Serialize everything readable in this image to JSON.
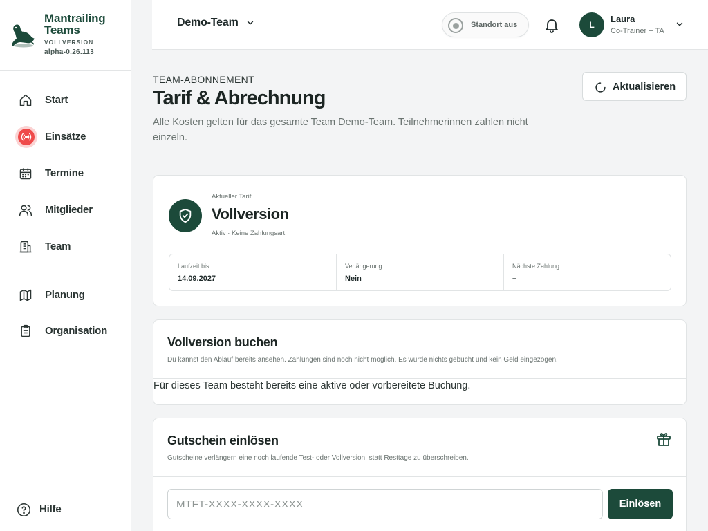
{
  "brand": {
    "title": "Mantrailing Teams",
    "plan": "VOLLVERSION",
    "version": "alpha-0.26.113"
  },
  "sidebar": {
    "items": [
      {
        "label": "Start",
        "icon": "home-icon"
      },
      {
        "label": "Einsätze",
        "icon": "alert-icon"
      },
      {
        "label": "Termine",
        "icon": "calendar-icon"
      },
      {
        "label": "Mitglieder",
        "icon": "users-icon"
      },
      {
        "label": "Team",
        "icon": "building-icon"
      },
      {
        "label": "Planung",
        "icon": "map-icon"
      },
      {
        "label": "Organisation",
        "icon": "clipboard-icon"
      }
    ],
    "help": {
      "label": "Hilfe",
      "icon": "help-icon"
    }
  },
  "header": {
    "team": "Demo-Team",
    "location": "Standort aus",
    "user": {
      "initial": "L",
      "name": "Laura",
      "role": "Co-Trainer + TA"
    }
  },
  "page": {
    "eyebrow": "TEAM-ABONNEMENT",
    "title": "Tarif & Abrechnung",
    "description": "Alle Kosten gelten für das gesamte Team Demo-Team. Teilnehmerinnen zahlen nicht einzeln.",
    "refresh_label": "Aktualisieren"
  },
  "current_plan": {
    "caption": "Aktueller Tarif",
    "name": "Vollversion",
    "status": "Aktiv · Keine Zahlungsart",
    "info": [
      {
        "label": "Laufzeit bis",
        "value": "14.09.2027"
      },
      {
        "label": "Verlängerung",
        "value": "Nein"
      },
      {
        "label": "Nächste Zahlung",
        "value": "–"
      }
    ]
  },
  "booking": {
    "title": "Vollversion buchen",
    "subtitle": "Du kannst den Ablauf bereits ansehen. Zahlungen sind noch nicht möglich. Es wurde nichts gebucht und kein Geld eingezogen.",
    "note": "Für dieses Team besteht bereits eine aktive oder vorbereitete Buchung."
  },
  "voucher": {
    "title": "Gutschein einlösen",
    "subtitle": "Gutscheine verlängern eine noch laufende Test- oder Vollversion, statt Resttage zu überschreiben.",
    "placeholder": "MTFT-XXXX-XXXX-XXXX",
    "button_label": "Einlösen"
  },
  "colors": {
    "brand": "#1c4a3a",
    "alert": "#ef4a4a",
    "background": "#f3f4f5"
  }
}
